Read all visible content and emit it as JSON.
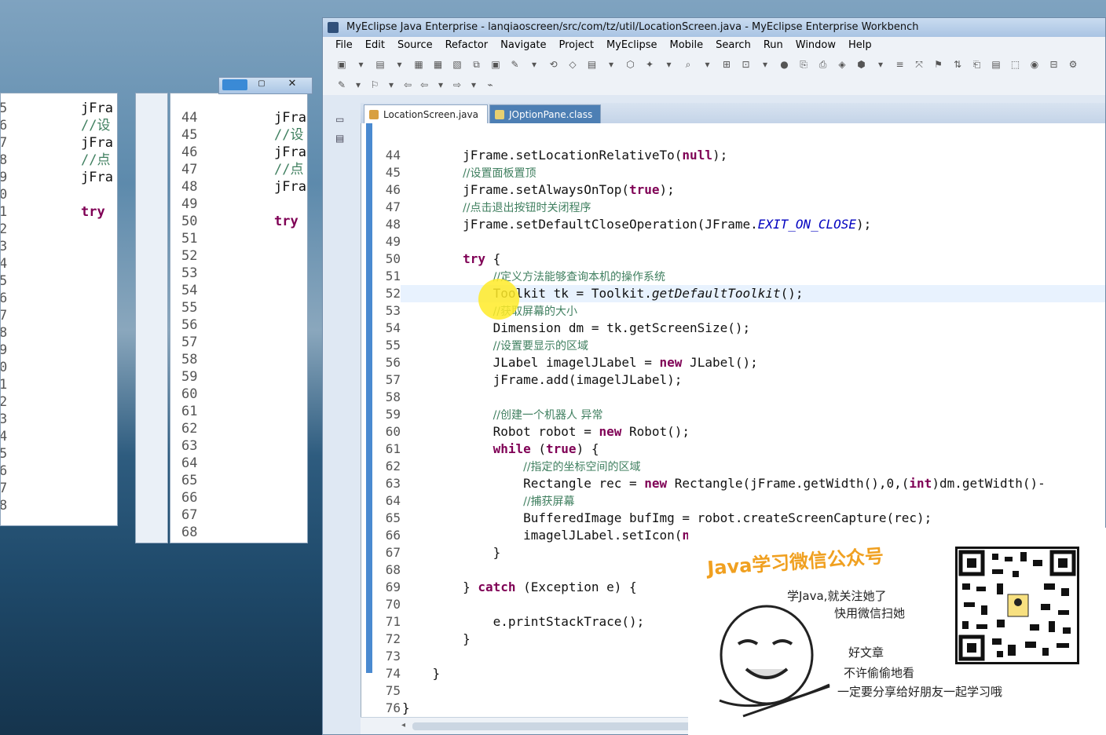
{
  "window": {
    "title": "MyEclipse Java Enterprise - lanqiaoscreen/src/com/tz/util/LocationScreen.java - MyEclipse Enterprise Workbench"
  },
  "menu": [
    "File",
    "Edit",
    "Source",
    "Refactor",
    "Navigate",
    "Project",
    "MyEclipse",
    "Mobile",
    "Search",
    "Run",
    "Window",
    "Help"
  ],
  "tabs": [
    {
      "label": "LocationScreen.java",
      "active": true
    },
    {
      "label": "JOptionPane.class",
      "active": false
    }
  ],
  "editor": {
    "current_line": 52,
    "lines": [
      {
        "n": "44",
        "text": "        jFrame.setLocationRelativeTo(null);"
      },
      {
        "n": "45",
        "text": "        //设置面板置顶"
      },
      {
        "n": "46",
        "text": "        jFrame.setAlwaysOnTop(true);"
      },
      {
        "n": "47",
        "text": "        //点击退出按钮时关闭程序"
      },
      {
        "n": "48",
        "text": "        jFrame.setDefaultCloseOperation(JFrame.EXIT_ON_CLOSE);"
      },
      {
        "n": "49",
        "text": ""
      },
      {
        "n": "50",
        "text": "        try {"
      },
      {
        "n": "51",
        "text": "            //定义方法能够查询本机的操作系统"
      },
      {
        "n": "52",
        "text": "            Toolkit tk = Toolkit.getDefaultToolkit();"
      },
      {
        "n": "53",
        "text": "            //获取屏幕的大小"
      },
      {
        "n": "54",
        "text": "            Dimension dm = tk.getScreenSize();"
      },
      {
        "n": "55",
        "text": "            //设置要显示的区域"
      },
      {
        "n": "56",
        "text": "            JLabel imagelJLabel = new JLabel();"
      },
      {
        "n": "57",
        "text": "            jFrame.add(imagelJLabel);"
      },
      {
        "n": "58",
        "text": ""
      },
      {
        "n": "59",
        "text": "            //创建一个机器人 异常"
      },
      {
        "n": "60",
        "text": "            Robot robot = new Robot();"
      },
      {
        "n": "61",
        "text": "            while (true) {"
      },
      {
        "n": "62",
        "text": "                //指定的坐标空间的区域"
      },
      {
        "n": "63",
        "text": "                Rectangle rec = new Rectangle(jFrame.getWidth(),0,(int)dm.getWidth()-"
      },
      {
        "n": "64",
        "text": "                //捕获屏幕"
      },
      {
        "n": "65",
        "text": "                BufferedImage bufImg = robot.createScreenCapture(rec);"
      },
      {
        "n": "66",
        "text": "                imagelJLabel.setIcon(new ImageIcon(bufImg));"
      },
      {
        "n": "67",
        "text": "            }"
      },
      {
        "n": "68",
        "text": ""
      },
      {
        "n": "69",
        "text": "        } catch (Exception e) {"
      },
      {
        "n": "70",
        "text": ""
      },
      {
        "n": "71",
        "text": "            e.printStackTrace();"
      },
      {
        "n": "72",
        "text": "        }"
      },
      {
        "n": "73",
        "text": ""
      },
      {
        "n": "74",
        "text": "    }"
      },
      {
        "n": "75",
        "text": ""
      },
      {
        "n": "76",
        "text": "}"
      }
    ]
  },
  "bg_window_1": {
    "lines": [
      "jFra",
      "//设",
      "jFra",
      "//点",
      "jFra",
      "",
      "try"
    ],
    "line_numbers_partial": [
      "5",
      "6",
      "7",
      "8",
      "9",
      "0",
      "1",
      "2",
      "3",
      "4",
      "5",
      "6",
      "7",
      "8",
      "9",
      "0",
      "1",
      "2",
      "3",
      "4",
      "5",
      "6",
      "7",
      "8"
    ]
  },
  "bg_window_2": {
    "line_numbers": [
      "44",
      "45",
      "46",
      "47",
      "48",
      "49",
      "50",
      "51",
      "52",
      "53",
      "54",
      "55",
      "56",
      "57",
      "58",
      "59",
      "60",
      "61",
      "62",
      "63",
      "64",
      "65",
      "66",
      "67",
      "68"
    ],
    "lines": [
      "jFra",
      "//设",
      "jFra",
      "//点",
      "jFra",
      "",
      "try"
    ]
  },
  "overlay": {
    "title": "Java学习微信公众号",
    "line1": "学Java,就关注她了",
    "line2": "快用微信扫她",
    "line3": "好文章",
    "line4": "不许偷偷地看",
    "line5": "一定要分享给好朋友一起学习哦"
  }
}
